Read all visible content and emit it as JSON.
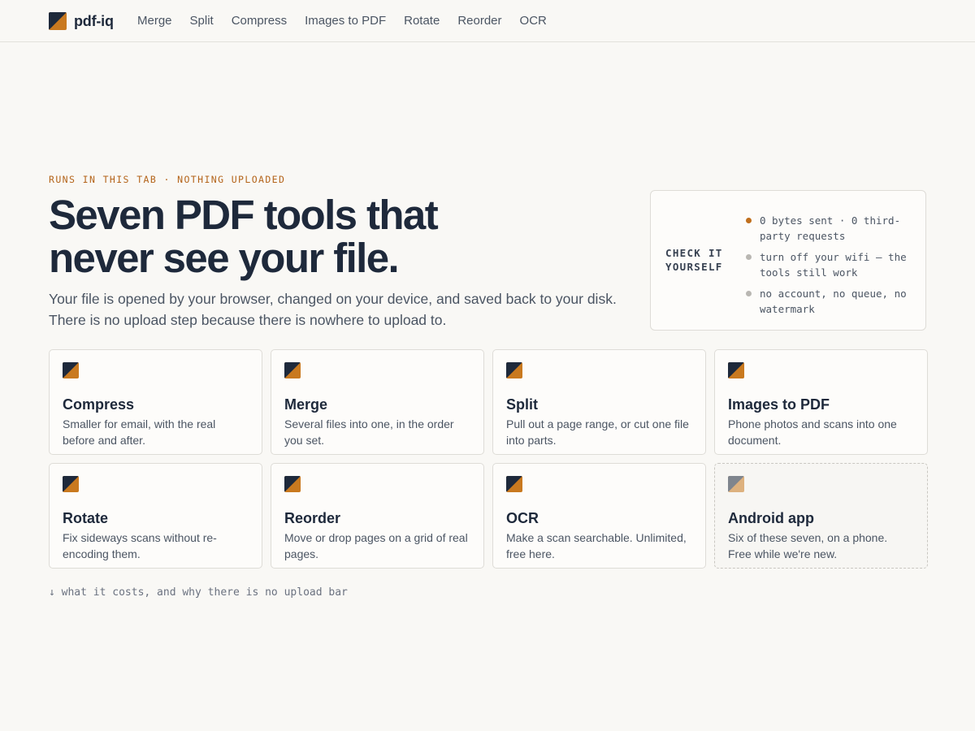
{
  "brand": {
    "name": "pdf-iq",
    "logo_icon": "pdf-iq-logo-icon",
    "colors": {
      "dark": "#1e293b",
      "accent": "#c9791f"
    }
  },
  "nav": {
    "items": [
      {
        "label": "Merge"
      },
      {
        "label": "Split"
      },
      {
        "label": "Compress"
      },
      {
        "label": "Images to PDF"
      },
      {
        "label": "Rotate"
      },
      {
        "label": "Reorder"
      },
      {
        "label": "OCR"
      }
    ]
  },
  "hero": {
    "eyebrow": "RUNS IN THIS TAB · NOTHING UPLOADED",
    "headline_line1": "Seven PDF tools that",
    "headline_line2": "never see your file.",
    "sub_line1": "Your file is opened by your browser, changed on your device, and saved back to your disk.",
    "sub_line2": "There is no upload step because there is nowhere to upload to."
  },
  "check": {
    "title": "CHECK IT YOURSELF",
    "items": [
      {
        "text": "0 bytes sent · 0 third-party requests"
      },
      {
        "text": "turn off your wifi — the tools still work"
      },
      {
        "text": "no account, no queue, no watermark"
      }
    ]
  },
  "tools": [
    {
      "title": "Compress",
      "desc": "Smaller for email, with the real before and after."
    },
    {
      "title": "Merge",
      "desc": "Several files into one, in the order you set."
    },
    {
      "title": "Split",
      "desc": "Pull out a page range, or cut one file into parts."
    },
    {
      "title": "Images to PDF",
      "desc": "Phone photos and scans into one document."
    },
    {
      "title": "Rotate",
      "desc": "Fix sideways scans without re-encoding them."
    },
    {
      "title": "Reorder",
      "desc": "Move or drop pages on a grid of real pages."
    },
    {
      "title": "OCR",
      "desc": "Make a scan searchable. Unlimited, free here."
    },
    {
      "title": "Android app",
      "desc": "Six of these seven, on a phone. Free while we're new."
    }
  ],
  "footer": {
    "link": "↓ what it costs, and why there is no upload bar"
  }
}
